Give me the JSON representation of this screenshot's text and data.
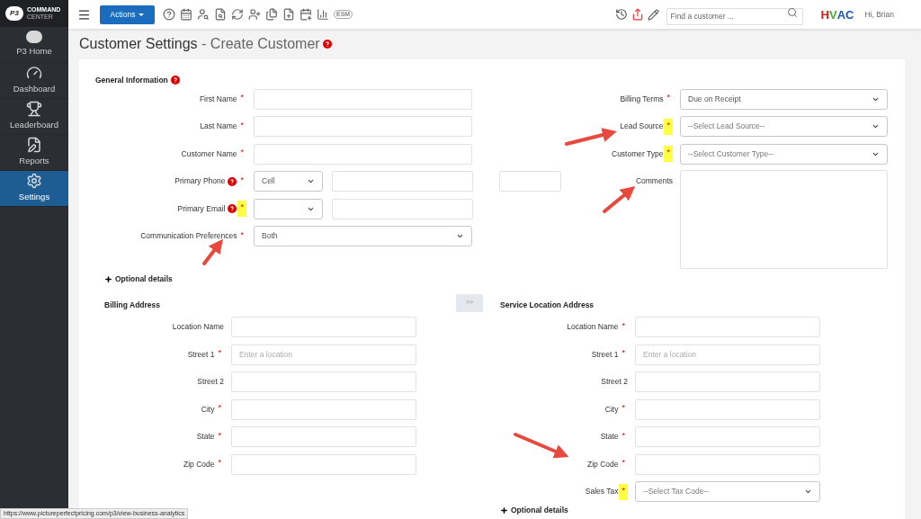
{
  "sidebar": {
    "logo": {
      "mark": "P3",
      "line_1": "COMMAND",
      "line_2": "CENTER"
    },
    "items": [
      {
        "label": "P3 Home",
        "selected": false
      },
      {
        "label": "Dashboard",
        "selected": false
      },
      {
        "label": "Leaderboard",
        "selected": false
      },
      {
        "label": "Reports",
        "selected": false
      },
      {
        "label": "Settings",
        "selected": true
      }
    ]
  },
  "topbar": {
    "actions_label": "Actions",
    "esm_label": "ESM",
    "search": {
      "placeholder": "Find a customer ..."
    },
    "brand": {
      "left": "H",
      "mid": "V",
      "right": "AC"
    },
    "greeting": "Hi, Brian"
  },
  "page_title": {
    "main": "Customer Settings",
    "separator": " - ",
    "sub": "Create Customer"
  },
  "general": {
    "heading": "General Information",
    "left": [
      {
        "kind": "text",
        "label": "First Name",
        "asterisk": "*",
        "highlighted": false
      },
      {
        "kind": "text",
        "label": "Last Name",
        "asterisk": "*",
        "highlighted": false
      },
      {
        "kind": "text",
        "label": "Customer Name",
        "asterisk": "*",
        "highlighted": false
      },
      {
        "kind": "phone",
        "label": "Primary Phone",
        "asterisk": "*",
        "highlighted": false,
        "type_value": "Cell"
      },
      {
        "kind": "email",
        "label": "Primary Email",
        "asterisk": "*",
        "highlighted": true
      },
      {
        "kind": "select",
        "label": "Communication Preferences",
        "asterisk": "*",
        "highlighted": false,
        "value": "Both"
      }
    ],
    "right": [
      {
        "kind": "select",
        "label": "Billing Terms",
        "asterisk": "*",
        "highlighted": false,
        "value": "Due on Receipt"
      },
      {
        "kind": "select",
        "label": "Lead Source",
        "asterisk": "*",
        "highlighted": true,
        "placeholder": "--Select Lead Source--"
      },
      {
        "kind": "select",
        "label": "Customer Type",
        "asterisk": "*",
        "highlighted": true,
        "placeholder": "--Select Customer Type--"
      },
      {
        "kind": "textarea",
        "label": "Comments"
      }
    ]
  },
  "optional_details": "Optional details",
  "billing_address": {
    "heading": "Billing Address",
    "fields": [
      {
        "kind": "text",
        "label": "Location Name"
      },
      {
        "kind": "text",
        "label": "Street 1",
        "asterisk": "*",
        "highlighted": false,
        "placeholder": "Enter a location"
      },
      {
        "kind": "text",
        "label": "Street 2"
      },
      {
        "kind": "text",
        "label": "City",
        "asterisk": "*",
        "highlighted": false
      },
      {
        "kind": "text",
        "label": "State",
        "asterisk": "*",
        "highlighted": false
      },
      {
        "kind": "text",
        "label": "Zip Code",
        "asterisk": "*",
        "highlighted": false
      }
    ]
  },
  "copy_button": ">>",
  "service_address": {
    "heading": "Service Location Address",
    "fields": [
      {
        "kind": "text",
        "label": "Location Name",
        "asterisk": "*",
        "highlighted": false
      },
      {
        "kind": "text",
        "label": "Street 1",
        "asterisk": "*",
        "highlighted": false,
        "placeholder": "Enter a location"
      },
      {
        "kind": "text",
        "label": "Street 2"
      },
      {
        "kind": "text",
        "label": "City",
        "asterisk": "*",
        "highlighted": false
      },
      {
        "kind": "text",
        "label": "State",
        "asterisk": "*",
        "highlighted": false
      },
      {
        "kind": "text",
        "label": "Zip Code",
        "asterisk": "*",
        "highlighted": false
      },
      {
        "kind": "select",
        "label": "Sales Tax",
        "asterisk": "*",
        "highlighted": true,
        "placeholder": "--Select Tax Code--"
      }
    ],
    "optional_details": "Optional details"
  },
  "status_bar": {
    "url": "https://www.pictureperfectpricing.com/p3/view-business-analytics"
  }
}
